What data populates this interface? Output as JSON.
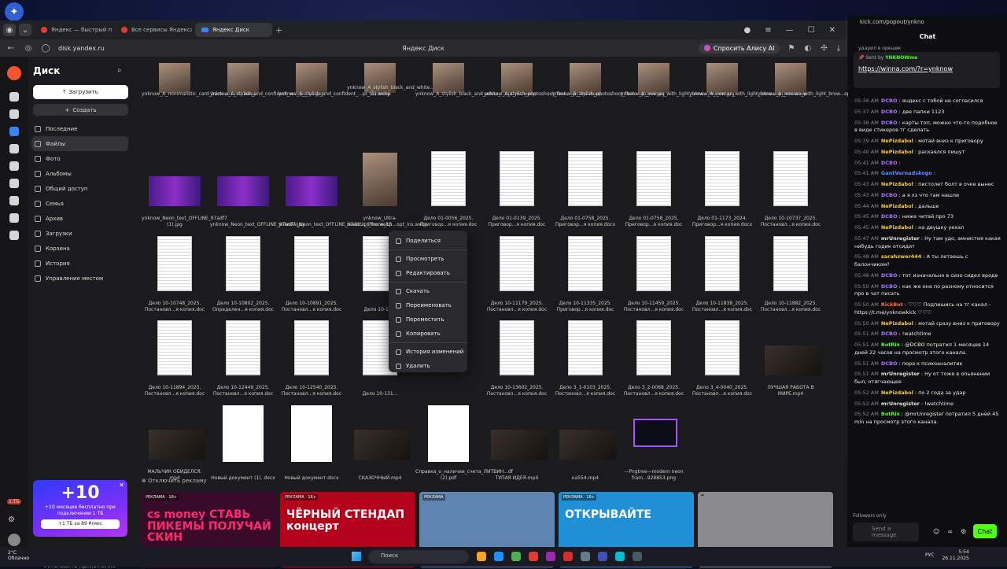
{
  "browser": {
    "tabs": [
      {
        "label": "Яндекс — быстрый поиск",
        "icon": "yandex-icon",
        "active": false
      },
      {
        "label": "Все сервисы Яндекса",
        "icon": "yandex-icon",
        "active": false
      },
      {
        "label": "Яндекс Диск",
        "icon": "disk-icon",
        "active": true
      }
    ],
    "url": "disk.yandex.ru",
    "page_title": "Яндекс Диск",
    "alisa_label": "Спросить Алису AI"
  },
  "sidebar": {
    "title": "Диск",
    "upload_label": "Загрузить",
    "create_label": "Создать",
    "items": [
      {
        "label": "Последние",
        "active": false
      },
      {
        "label": "Файлы",
        "active": true
      },
      {
        "label": "Фото",
        "active": false
      },
      {
        "label": "Альбомы",
        "active": false
      },
      {
        "label": "Общий доступ",
        "active": false
      },
      {
        "label": "Семья",
        "active": false
      },
      {
        "label": "Архив",
        "active": false
      },
      {
        "label": "Загрузки",
        "active": false
      },
      {
        "label": "Корзина",
        "active": false
      },
      {
        "label": "История",
        "active": false
      },
      {
        "label": "Управление местом",
        "active": false
      }
    ],
    "promo": {
      "big": "+10",
      "text": "+10 месяцев бесплатно при подключении 1 ТБ",
      "button": "+1 ТБ за 89 ₽/мес"
    },
    "install_label": "Установить приложение",
    "storage_badge": "1 ТБ"
  },
  "files": [
    [
      {
        "name": "ynknow_A_minimalistic_card_back...01297.webp",
        "kind": "img"
      },
      {
        "name": "ynknow_A_stylish_and_confident_w...opt_ins.jpg",
        "kind": "img"
      },
      {
        "name": "ynknow_A_stylish_and_confident_...pt_ins.webp",
        "kind": "img"
      },
      {
        "name": "ynknow_A_stylish_black_and_white...ns (1).webp",
        "kind": "img"
      },
      {
        "name": "ynknow_A_stylish_black_and_white_...opt_ins.webp",
        "kind": "img"
      },
      {
        "name": "ynknow_A_stylish_photoshoot_feat...opt_ins.webp",
        "kind": "img"
      },
      {
        "name": "ynknow_A_stylish_photoshoot_feat...opt_ins.jpg",
        "kind": "img"
      },
      {
        "name": "ynknow_A_woman_with_light_brow...760_ins.jpg",
        "kind": "img"
      },
      {
        "name": "ynknow_A_woman_with_light_brow...opt_ins.webp",
        "kind": "img"
      },
      {
        "name": "ynknow_A_woman_with_light_brow...opt_ins.webp",
        "kind": "img"
      }
    ],
    [
      {
        "name": "ynknow_Neon_text_OFFLINE_97adf7 (1).jpg",
        "kind": "neon"
      },
      {
        "name": "ynknow_Neon_text_OFFLINE_97adf7.jpg",
        "kind": "neon"
      },
      {
        "name": "ynknow_Neon_text_OFFLINE_97ad...pt_ins.webp",
        "kind": "neon"
      },
      {
        "name": "ynknow_Ultra-realistic_iPhone_15...opt_ins.webp",
        "kind": "img"
      },
      {
        "name": "Дело 01-0056_2025. Приговор...я копия.doc",
        "kind": "doc"
      },
      {
        "name": "Дело 01-0139_2025. Приговор...я копия.doc",
        "kind": "doc"
      },
      {
        "name": "Дело 01-0758_2025. Приговор...я копия.docx",
        "kind": "doc"
      },
      {
        "name": "Дело 01-0758_2025. Приговор...я копия.doc",
        "kind": "doc"
      },
      {
        "name": "Дело 01-1173_2024. Приговор...я копия.docx",
        "kind": "doc"
      },
      {
        "name": "Дело 10-10737_2025. Постановл...я копия.doc",
        "kind": "doc"
      }
    ],
    [
      {
        "name": "Дело 10-10748_2025. Постановл...я копия.doc",
        "kind": "doc"
      },
      {
        "name": "Дело 10-10802_2025. Определен...я копия.doc",
        "kind": "doc"
      },
      {
        "name": "Дело 10-10891_2025. Постановл...я копия.doc",
        "kind": "doc"
      },
      {
        "name": "Дело 10-11...",
        "kind": "doc"
      },
      {
        "name": "",
        "kind": "none"
      },
      {
        "name": "Дело 10-11179_2025. Постановл...я копия.doc",
        "kind": "doc"
      },
      {
        "name": "Дело 10-11335_2025. Приговор...я копия.doc",
        "kind": "doc"
      },
      {
        "name": "Дело 10-11459_2025. Постановл...я копия.doc",
        "kind": "doc"
      },
      {
        "name": "Дело 10-11838_2025. Постановл...я копия.doc",
        "kind": "doc"
      },
      {
        "name": "Дело 10-11882_2025. Постановл...я копия.doc",
        "kind": "doc"
      }
    ],
    [
      {
        "name": "Дело 10-11894_2025. Постановл...я копия.doc",
        "kind": "doc"
      },
      {
        "name": "Дело 10-12449_2025. Постановл...я копия.doc",
        "kind": "doc"
      },
      {
        "name": "Дело 10-12540_2025. Постановл...я копия.doc",
        "kind": "doc"
      },
      {
        "name": "Дело 10-131...",
        "kind": "doc"
      },
      {
        "name": "",
        "kind": "none"
      },
      {
        "name": "Дело 10-13602_2025. Постановл...я копия.doc",
        "kind": "doc"
      },
      {
        "name": "Дело 3_1-0103_2025. Постановл...я копия.doc",
        "kind": "doc"
      },
      {
        "name": "Дело 3_2-0068_2025. Постановл...я копия.doc",
        "kind": "doc"
      },
      {
        "name": "Дело 3_4-0040_2025. Постановл...я копия.doc",
        "kind": "doc"
      },
      {
        "name": "ЛУЧШАЯ РАБОТА В МИРЕ.mp4",
        "kind": "vid"
      }
    ],
    [
      {
        "name": "МАЛЬЧИК ОБИДЕЛСЯ. mp4",
        "kind": "vid"
      },
      {
        "name": "Новый документ (1). docx",
        "kind": "blank"
      },
      {
        "name": "Новый документ.docx",
        "kind": "blank"
      },
      {
        "name": "СКАЗОЧНЫЙ.mp4",
        "kind": "vid"
      },
      {
        "name": "Справка_о_наличии_счета_ЛИТВИН...df (2).pdf",
        "kind": "blank"
      },
      {
        "name": "ТУПАЯ ИДЕЯ.mp4",
        "kind": "vid"
      },
      {
        "name": "ка554.mp4",
        "kind": "vid"
      },
      {
        "name": "—Pngtree—modern neon fram...928853.png",
        "kind": "frame"
      }
    ]
  ],
  "context_menu": [
    {
      "label": "Поделиться",
      "icon": "share-icon"
    },
    {
      "sep": true
    },
    {
      "label": "Просмотреть",
      "icon": "eye-icon"
    },
    {
      "label": "Редактировать",
      "icon": "pencil-icon"
    },
    {
      "sep": true
    },
    {
      "label": "Скачать",
      "icon": "download-icon"
    },
    {
      "label": "Переименовать",
      "icon": "rename-icon"
    },
    {
      "label": "Переместить",
      "icon": "move-icon"
    },
    {
      "label": "Копировать",
      "icon": "copy-icon"
    },
    {
      "sep": true
    },
    {
      "label": "История изменений",
      "icon": "history-icon"
    },
    {
      "label": "Удалить",
      "icon": "trash-icon"
    }
  ],
  "ads": {
    "disable_label": "Отключить рекламу",
    "items": [
      {
        "tag": "РЕКЛАМА · 18+",
        "text": "cs money СТАВЬ ПИКЕМЫ ПОЛУЧАЙ СКИН",
        "bg": "#3a0a2a"
      },
      {
        "tag": "РЕКЛАМА · 16+",
        "text": "ЧЁРНЫЙ СТЕНДАП концерт",
        "bg": "#b3001b"
      },
      {
        "tag": "РЕКЛАМА",
        "text": "",
        "bg": "#5f84b0"
      },
      {
        "tag": "РЕКЛАМА · 16+",
        "text": "ОТКРЫВАЙТЕ",
        "bg": "#1f8fd6"
      },
      {
        "tag": "",
        "text": "",
        "bg": "#8a8a8e"
      }
    ]
  },
  "chat": {
    "url": "kick.com/popout/ynkno",
    "title": "Chat",
    "pinned_first": "ударил в орешек",
    "pinned_sender": "YNKNOWme",
    "pinned_link": "https://winna.com/?r=ynknow",
    "messages": [
      {
        "t": "05:36 AM",
        "u": "DCBO",
        "c": "#a970ff",
        "m": "яндекс с тобой не согласился"
      },
      {
        "t": "05:37 AM",
        "u": "DCBO",
        "c": "#a970ff",
        "m": "две папки 1123"
      },
      {
        "t": "05:38 AM",
        "u": "DCBO",
        "c": "#a970ff",
        "m": "карты топ, можно что-то подобное в виде стикеров тг сделать"
      },
      {
        "t": "05:39 AM",
        "u": "NePizdabol",
        "c": "#f5c542",
        "m": "мотай вниз к приговору"
      },
      {
        "t": "05:40 AM",
        "u": "NePizdabol",
        "c": "#f5c542",
        "m": "раскаялся пишут"
      },
      {
        "t": "05:41 AM",
        "u": "DCBO",
        "c": "#a970ff",
        "m": ""
      },
      {
        "t": "05:41 AM",
        "u": "GantVernadskogo",
        "c": "#5b8cff",
        "m": ""
      },
      {
        "t": "05:43 AM",
        "u": "NePizdabol",
        "c": "#f5c542",
        "m": "пистолет болт в очке вынес"
      },
      {
        "t": "05:43 AM",
        "u": "DCBO",
        "c": "#a970ff",
        "m": "а я хз что там нашли"
      },
      {
        "t": "05:44 AM",
        "u": "NePizdabol",
        "c": "#f5c542",
        "m": "дальше"
      },
      {
        "t": "05:45 AM",
        "u": "DCBO",
        "c": "#a970ff",
        "m": "ниже читай про 73"
      },
      {
        "t": "05:45 AM",
        "u": "NePizdabol",
        "c": "#f5c542",
        "m": "на двушку уехал"
      },
      {
        "t": "05:47 AM",
        "u": "mrUnregister",
        "c": "#e0e0e0",
        "m": "Ну там удо, амнистия какая нибудь годик отсидит"
      },
      {
        "t": "05:48 AM",
        "u": "sarahzwer444",
        "c": "#f5c542",
        "m": "А ты летаешь с балончиком?"
      },
      {
        "t": "05:48 AM",
        "u": "DCBO",
        "c": "#a970ff",
        "m": "тот изначально в сизо сидел вроде"
      },
      {
        "t": "05:50 AM",
        "u": "DCBO",
        "c": "#a970ff",
        "m": "как же она по разному относится про в чат писать"
      },
      {
        "t": "05:50 AM",
        "u": "RickBot",
        "c": "#ff6a3d",
        "m": "♡♡♡ Подпишись на тг канал - https://t.me/ynknowkick ♡♡♡"
      },
      {
        "t": "05:50 AM",
        "u": "NePizdabol",
        "c": "#f5c542",
        "m": "мотай сразу вниз к приговору"
      },
      {
        "t": "05:51 AM",
        "u": "DCBO",
        "c": "#a970ff",
        "m": "!watchtime"
      },
      {
        "t": "05:51 AM",
        "u": "BotRix",
        "c": "#53fc18",
        "m": "@DCBO потратил 1 месяцев 14 дней 22 часов на просмотр этого канала."
      },
      {
        "t": "05:51 AM",
        "u": "DCBO",
        "c": "#a970ff",
        "m": "пора к психоаналитик"
      },
      {
        "t": "05:51 AM",
        "u": "mrUnregister",
        "c": "#e0e0e0",
        "m": "Ну от тоже в опьянении был, отягчающее"
      },
      {
        "t": "05:52 AM",
        "u": "NePizdabol",
        "c": "#f5c542",
        "m": "по 2 года за удар"
      },
      {
        "t": "05:52 AM",
        "u": "mrUnregister",
        "c": "#e0e0e0",
        "m": "!watchtime"
      },
      {
        "t": "05:52 AM",
        "u": "BotRix",
        "c": "#53fc18",
        "m": "@mrUnregister потратил 5 дней 45 min на просмотр этого канала."
      }
    ],
    "followers_only": "Followers only",
    "send_placeholder": "Send a message",
    "chat_button": "Chat"
  },
  "taskbar": {
    "weather_temp": "2°C",
    "weather_desc": "Облачно",
    "search_label": "Поиск",
    "lang": "РУС",
    "time": "5:54",
    "date": "26.11.2025"
  }
}
